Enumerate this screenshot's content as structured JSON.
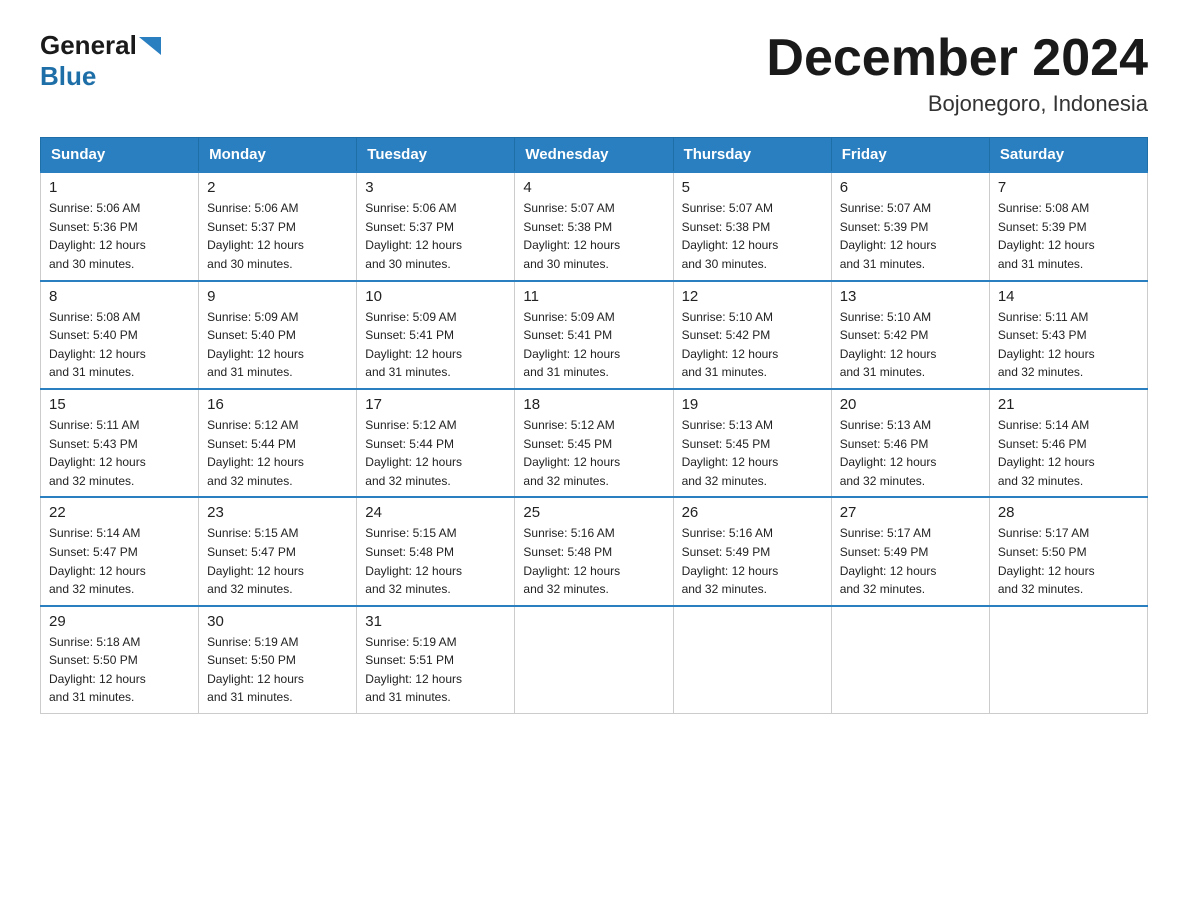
{
  "header": {
    "logo_general": "General",
    "logo_blue": "Blue",
    "month_title": "December 2024",
    "location": "Bojonegoro, Indonesia"
  },
  "days_of_week": [
    "Sunday",
    "Monday",
    "Tuesday",
    "Wednesday",
    "Thursday",
    "Friday",
    "Saturday"
  ],
  "weeks": [
    [
      {
        "day": "1",
        "sunrise": "5:06 AM",
        "sunset": "5:36 PM",
        "daylight": "12 hours and 30 minutes."
      },
      {
        "day": "2",
        "sunrise": "5:06 AM",
        "sunset": "5:37 PM",
        "daylight": "12 hours and 30 minutes."
      },
      {
        "day": "3",
        "sunrise": "5:06 AM",
        "sunset": "5:37 PM",
        "daylight": "12 hours and 30 minutes."
      },
      {
        "day": "4",
        "sunrise": "5:07 AM",
        "sunset": "5:38 PM",
        "daylight": "12 hours and 30 minutes."
      },
      {
        "day": "5",
        "sunrise": "5:07 AM",
        "sunset": "5:38 PM",
        "daylight": "12 hours and 30 minutes."
      },
      {
        "day": "6",
        "sunrise": "5:07 AM",
        "sunset": "5:39 PM",
        "daylight": "12 hours and 31 minutes."
      },
      {
        "day": "7",
        "sunrise": "5:08 AM",
        "sunset": "5:39 PM",
        "daylight": "12 hours and 31 minutes."
      }
    ],
    [
      {
        "day": "8",
        "sunrise": "5:08 AM",
        "sunset": "5:40 PM",
        "daylight": "12 hours and 31 minutes."
      },
      {
        "day": "9",
        "sunrise": "5:09 AM",
        "sunset": "5:40 PM",
        "daylight": "12 hours and 31 minutes."
      },
      {
        "day": "10",
        "sunrise": "5:09 AM",
        "sunset": "5:41 PM",
        "daylight": "12 hours and 31 minutes."
      },
      {
        "day": "11",
        "sunrise": "5:09 AM",
        "sunset": "5:41 PM",
        "daylight": "12 hours and 31 minutes."
      },
      {
        "day": "12",
        "sunrise": "5:10 AM",
        "sunset": "5:42 PM",
        "daylight": "12 hours and 31 minutes."
      },
      {
        "day": "13",
        "sunrise": "5:10 AM",
        "sunset": "5:42 PM",
        "daylight": "12 hours and 31 minutes."
      },
      {
        "day": "14",
        "sunrise": "5:11 AM",
        "sunset": "5:43 PM",
        "daylight": "12 hours and 32 minutes."
      }
    ],
    [
      {
        "day": "15",
        "sunrise": "5:11 AM",
        "sunset": "5:43 PM",
        "daylight": "12 hours and 32 minutes."
      },
      {
        "day": "16",
        "sunrise": "5:12 AM",
        "sunset": "5:44 PM",
        "daylight": "12 hours and 32 minutes."
      },
      {
        "day": "17",
        "sunrise": "5:12 AM",
        "sunset": "5:44 PM",
        "daylight": "12 hours and 32 minutes."
      },
      {
        "day": "18",
        "sunrise": "5:12 AM",
        "sunset": "5:45 PM",
        "daylight": "12 hours and 32 minutes."
      },
      {
        "day": "19",
        "sunrise": "5:13 AM",
        "sunset": "5:45 PM",
        "daylight": "12 hours and 32 minutes."
      },
      {
        "day": "20",
        "sunrise": "5:13 AM",
        "sunset": "5:46 PM",
        "daylight": "12 hours and 32 minutes."
      },
      {
        "day": "21",
        "sunrise": "5:14 AM",
        "sunset": "5:46 PM",
        "daylight": "12 hours and 32 minutes."
      }
    ],
    [
      {
        "day": "22",
        "sunrise": "5:14 AM",
        "sunset": "5:47 PM",
        "daylight": "12 hours and 32 minutes."
      },
      {
        "day": "23",
        "sunrise": "5:15 AM",
        "sunset": "5:47 PM",
        "daylight": "12 hours and 32 minutes."
      },
      {
        "day": "24",
        "sunrise": "5:15 AM",
        "sunset": "5:48 PM",
        "daylight": "12 hours and 32 minutes."
      },
      {
        "day": "25",
        "sunrise": "5:16 AM",
        "sunset": "5:48 PM",
        "daylight": "12 hours and 32 minutes."
      },
      {
        "day": "26",
        "sunrise": "5:16 AM",
        "sunset": "5:49 PM",
        "daylight": "12 hours and 32 minutes."
      },
      {
        "day": "27",
        "sunrise": "5:17 AM",
        "sunset": "5:49 PM",
        "daylight": "12 hours and 32 minutes."
      },
      {
        "day": "28",
        "sunrise": "5:17 AM",
        "sunset": "5:50 PM",
        "daylight": "12 hours and 32 minutes."
      }
    ],
    [
      {
        "day": "29",
        "sunrise": "5:18 AM",
        "sunset": "5:50 PM",
        "daylight": "12 hours and 31 minutes."
      },
      {
        "day": "30",
        "sunrise": "5:19 AM",
        "sunset": "5:50 PM",
        "daylight": "12 hours and 31 minutes."
      },
      {
        "day": "31",
        "sunrise": "5:19 AM",
        "sunset": "5:51 PM",
        "daylight": "12 hours and 31 minutes."
      },
      null,
      null,
      null,
      null
    ]
  ],
  "labels": {
    "sunrise": "Sunrise:",
    "sunset": "Sunset:",
    "daylight": "Daylight:"
  }
}
